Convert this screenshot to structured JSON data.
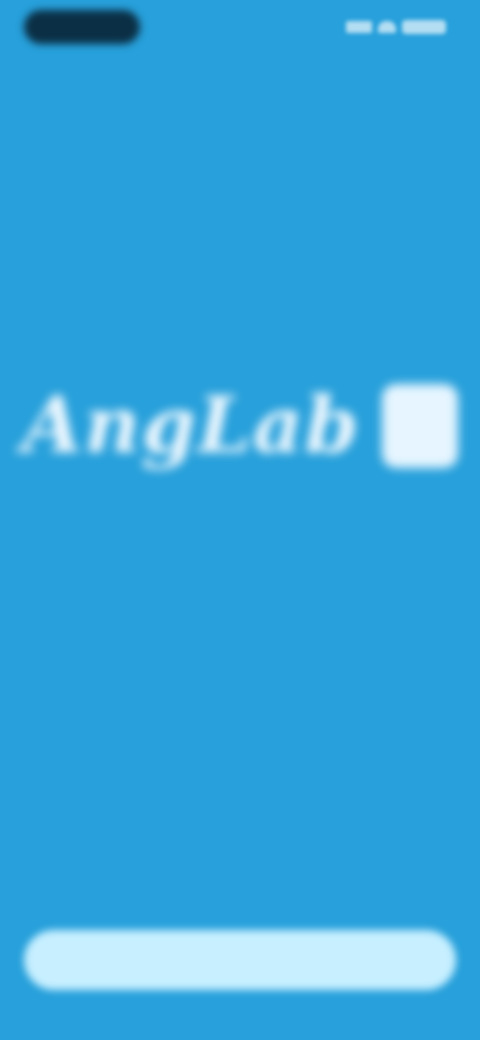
{
  "status_bar": {
    "time": ""
  },
  "hero": {
    "brand_name": "AngLab",
    "brand_badge_glyph": "",
    "tagline": ""
  },
  "footer": {
    "label": "",
    "cta_label": ""
  },
  "colors": {
    "background": "#27a0db",
    "cta_background": "#c7efff",
    "status_pill": "#0b2f45"
  }
}
